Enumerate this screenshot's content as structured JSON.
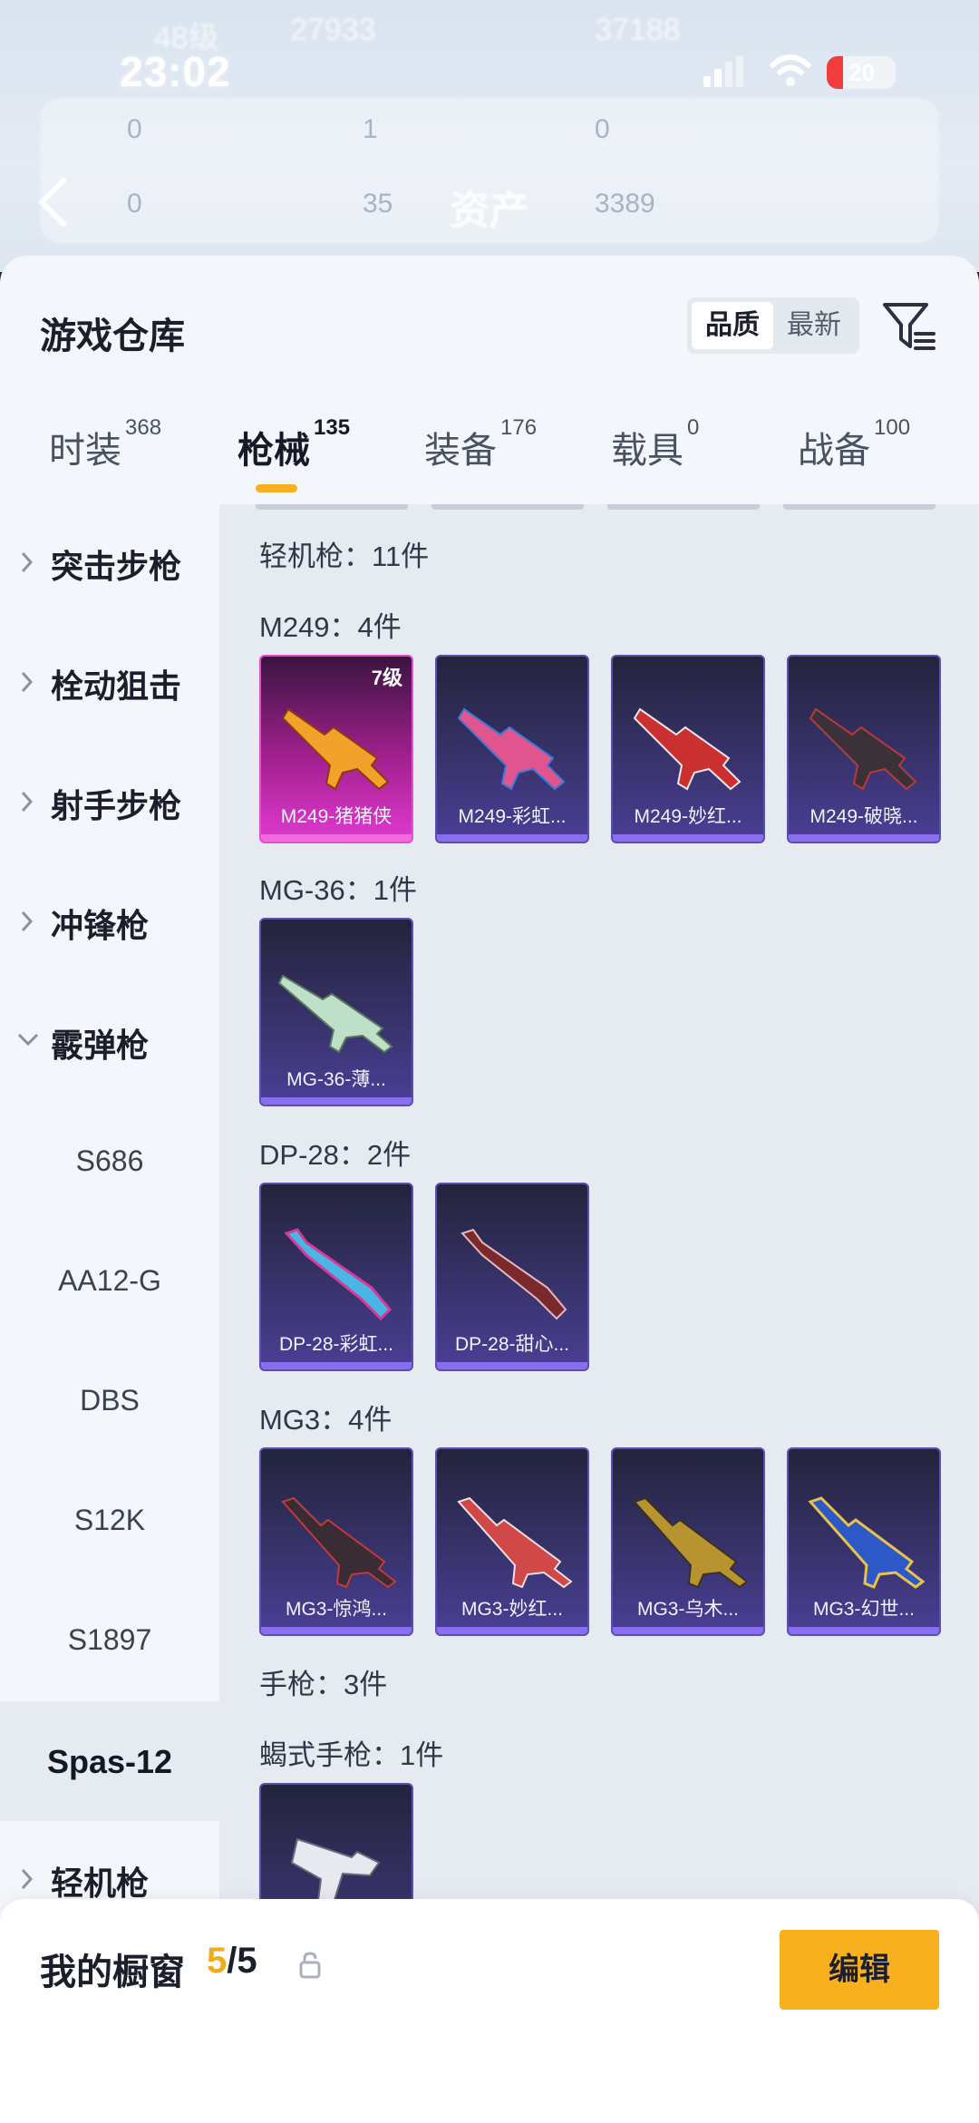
{
  "status_bar": {
    "time": "23:02",
    "battery": "20",
    "ghost_level": "48级",
    "ghost_coins_left": "27933",
    "ghost_coins_right": "37188"
  },
  "header": {
    "ghost_title": "资产",
    "ghost_row1": [
      "0",
      "1",
      "0"
    ],
    "ghost_row2": [
      "0",
      "35",
      "3389"
    ]
  },
  "sheet": {
    "title": "游戏仓库",
    "sort_options": [
      "品质",
      "最新"
    ],
    "active_sort": "品质"
  },
  "tabs": [
    {
      "label": "时装",
      "count": "368"
    },
    {
      "label": "枪械",
      "count": "135"
    },
    {
      "label": "装备",
      "count": "176"
    },
    {
      "label": "载具",
      "count": "0"
    },
    {
      "label": "战备",
      "count": "100"
    }
  ],
  "sidebar": {
    "categories": [
      {
        "label": "突击步枪"
      },
      {
        "label": "栓动狙击"
      },
      {
        "label": "射手步枪"
      },
      {
        "label": "冲锋枪"
      },
      {
        "label": "霰弹枪"
      }
    ],
    "sub_items": [
      "S686",
      "AA12-G",
      "DBS",
      "S12K",
      "S1897",
      "Spas-12"
    ],
    "last_category": "轻机枪"
  },
  "content": {
    "group_title": "轻机枪：11件",
    "sections": [
      {
        "title": "M249：4件",
        "items": [
          {
            "name": "M249-猪猪侠",
            "level": "7级"
          },
          {
            "name": "M249-彩虹..."
          },
          {
            "name": "M249-妙红..."
          },
          {
            "name": "M249-破晓..."
          }
        ]
      },
      {
        "title": "MG-36：1件",
        "items": [
          {
            "name": "MG-36-薄..."
          }
        ]
      },
      {
        "title": "DP-28：2件",
        "items": [
          {
            "name": "DP-28-彩虹..."
          },
          {
            "name": "DP-28-甜心..."
          }
        ]
      },
      {
        "title": "MG3：4件",
        "items": [
          {
            "name": "MG3-惊鸿..."
          },
          {
            "name": "MG3-妙红..."
          },
          {
            "name": "MG3-乌木..."
          },
          {
            "name": "MG3-幻世..."
          }
        ]
      }
    ],
    "pistol_group_title": "手枪：3件",
    "pistol_section_title": "蝎式手枪：1件"
  },
  "bottom_bar": {
    "label": "我的橱窗",
    "count_current": "5",
    "count_total": "/5",
    "edit_label": "编辑"
  },
  "colors": {
    "accent": "#f8b01e",
    "card_purple": "#3a3470",
    "card_pink": "#e03ad0"
  }
}
